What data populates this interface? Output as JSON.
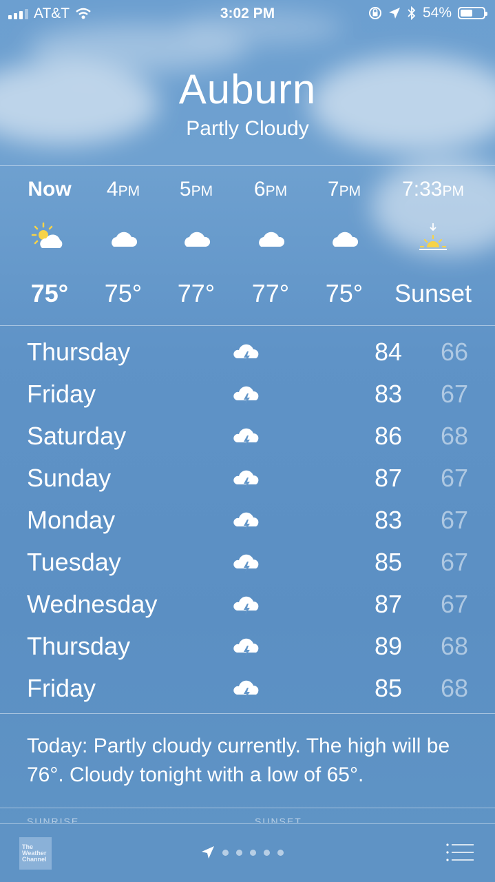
{
  "status_bar": {
    "carrier": "AT&T",
    "time": "3:02 PM",
    "battery": "54%",
    "battery_level": 0.54
  },
  "location": {
    "city": "Auburn",
    "condition": "Partly Cloudy"
  },
  "hourly": [
    {
      "time": "Now",
      "suffix": "",
      "icon": "partly-sunny-icon",
      "temp": "75°"
    },
    {
      "time": "4",
      "suffix": "PM",
      "icon": "cloud-icon",
      "temp": "75°"
    },
    {
      "time": "5",
      "suffix": "PM",
      "icon": "cloud-icon",
      "temp": "77°"
    },
    {
      "time": "6",
      "suffix": "PM",
      "icon": "cloud-icon",
      "temp": "77°"
    },
    {
      "time": "7",
      "suffix": "PM",
      "icon": "cloud-icon",
      "temp": "75°"
    },
    {
      "time": "7:33",
      "suffix": "PM",
      "icon": "sunset-icon",
      "temp": "Sunset"
    }
  ],
  "daily": [
    {
      "day": "Thursday",
      "icon": "thunderstorm-icon",
      "high": "84",
      "low": "66"
    },
    {
      "day": "Friday",
      "icon": "thunderstorm-icon",
      "high": "83",
      "low": "67"
    },
    {
      "day": "Saturday",
      "icon": "thunderstorm-icon",
      "high": "86",
      "low": "68"
    },
    {
      "day": "Sunday",
      "icon": "thunderstorm-icon",
      "high": "87",
      "low": "67"
    },
    {
      "day": "Monday",
      "icon": "thunderstorm-icon",
      "high": "83",
      "low": "67"
    },
    {
      "day": "Tuesday",
      "icon": "thunderstorm-icon",
      "high": "85",
      "low": "67"
    },
    {
      "day": "Wednesday",
      "icon": "thunderstorm-icon",
      "high": "87",
      "low": "67"
    },
    {
      "day": "Thursday",
      "icon": "thunderstorm-icon",
      "high": "89",
      "low": "68"
    },
    {
      "day": "Friday",
      "icon": "thunderstorm-icon",
      "high": "85",
      "low": "68"
    }
  ],
  "summary": "Today: Partly cloudy currently. The high will be 76°. Cloudy tonight with a low of 65°.",
  "details_peek": {
    "sunrise_label": "SUNRISE",
    "sunset_label": "SUNSET"
  },
  "bottom_bar": {
    "logo_lines": [
      "The",
      "Weather",
      "Channel"
    ],
    "page_dots": 5
  }
}
